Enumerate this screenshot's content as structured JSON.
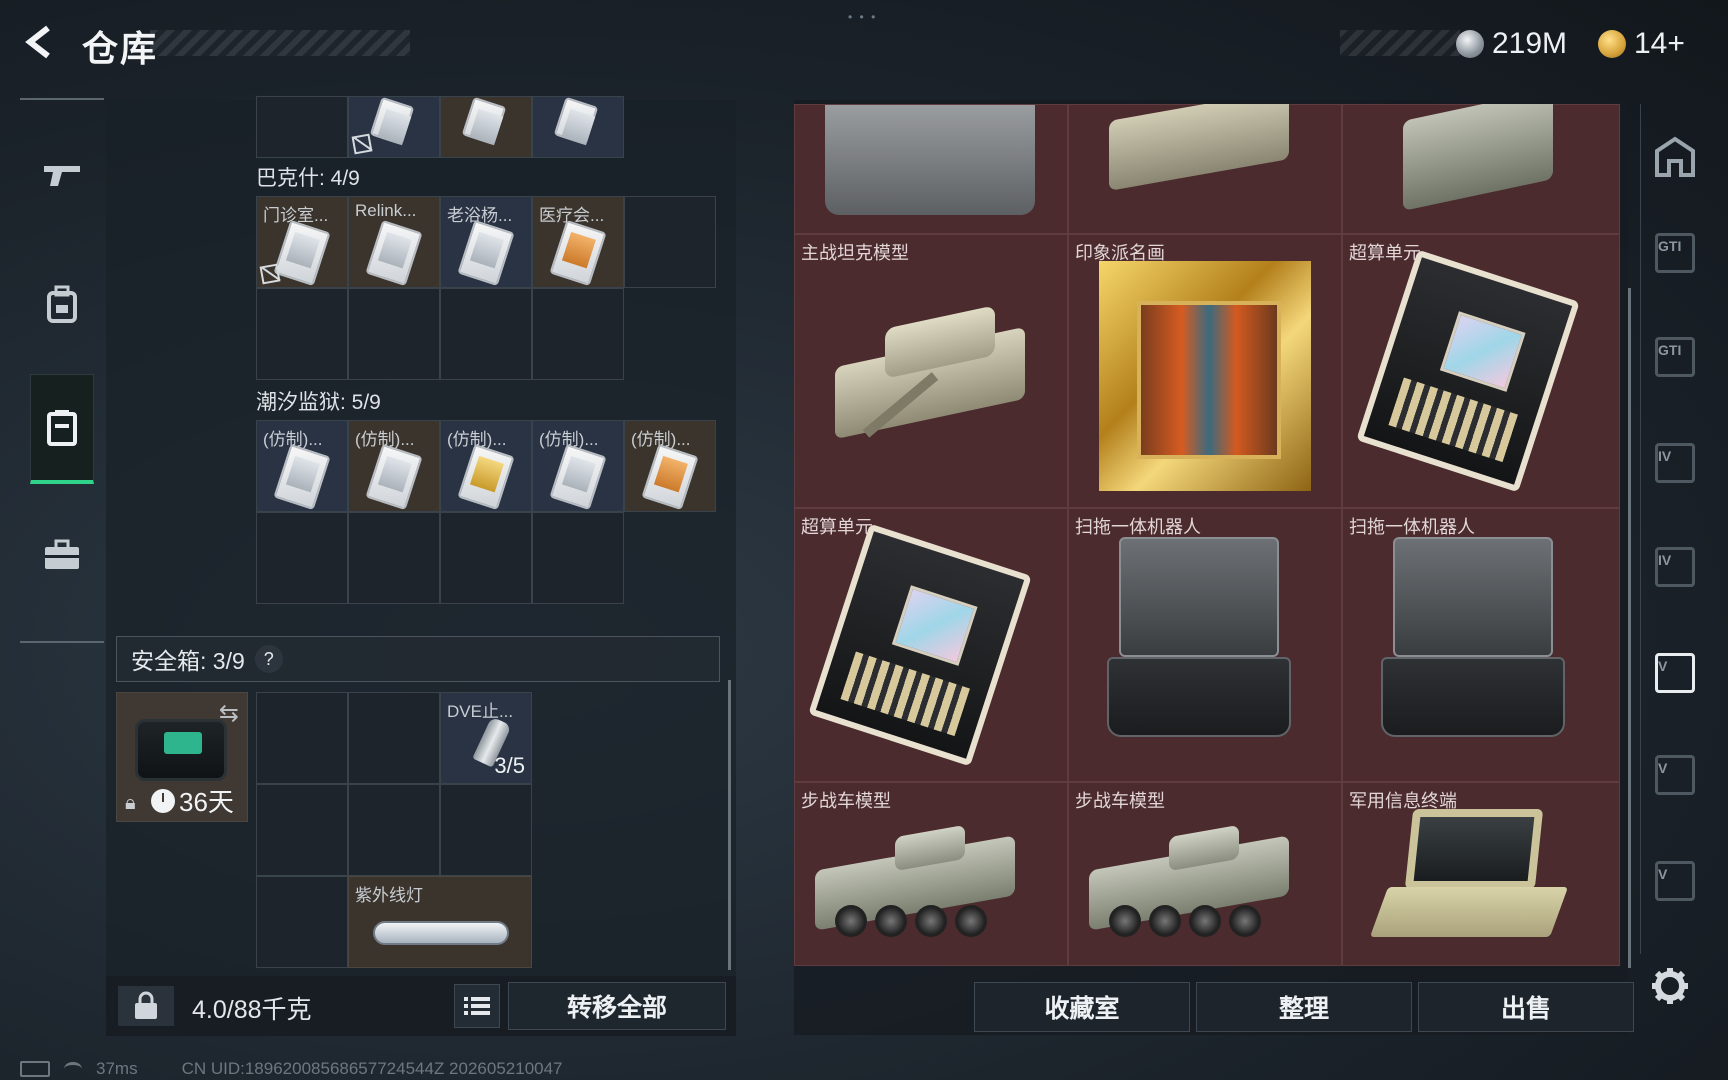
{
  "header": {
    "title": "仓库",
    "currencies": [
      {
        "icon": "silver-coin-icon",
        "value": "219M"
      },
      {
        "icon": "gold-ticket-icon",
        "value": "14+"
      }
    ]
  },
  "left_nav": [
    "gun-icon",
    "backpack-icon",
    "vest-icon",
    "briefcase-icon"
  ],
  "containers": [
    {
      "title": "巴克什: 4/9",
      "items": [
        "门诊室...",
        "Relink...",
        "老浴杨...",
        "医疗会..."
      ]
    },
    {
      "title": "潮汐监狱: 5/9",
      "items": [
        "(仿制)...",
        "(仿制)...",
        "(仿制)...",
        "(仿制)...",
        "(仿制)..."
      ]
    }
  ],
  "safe": {
    "title": "安全箱: 3/9",
    "help": "?",
    "timer": "36天",
    "mag_label": "DVE止...",
    "mag_count": "3/5",
    "uv_label": "紫外线灯"
  },
  "footer_left": {
    "weight": "4.0/88千克",
    "transfer_all": "转移全部"
  },
  "status": {
    "ping": "37ms",
    "uid": "CN UID:18962008568657724544Z 202605210047"
  },
  "stash_items": [
    {
      "label": "主战坦克模型"
    },
    {
      "label": "印象派名画"
    },
    {
      "label": "超算单元"
    },
    {
      "label": "超算单元"
    },
    {
      "label": "扫拖一体机器人"
    },
    {
      "label": "扫拖一体机器人"
    },
    {
      "label": "步战车模型"
    },
    {
      "label": "步战车模型"
    },
    {
      "label": "军用信息终端"
    }
  ],
  "right_buttons": {
    "collection": "收藏室",
    "sort": "整理",
    "sell": "出售"
  },
  "right_tabs": [
    "home-tab",
    "GTI",
    "GTI",
    "IV",
    "IV",
    "V",
    "V",
    "V"
  ],
  "colors": {
    "accent_green": "#2fd38a",
    "stash_bg": "#4a2a2d"
  }
}
